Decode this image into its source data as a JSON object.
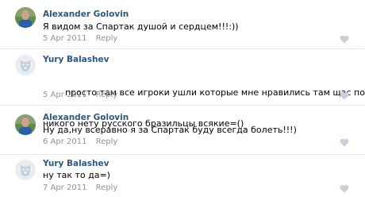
{
  "reply_label": "Reply",
  "colors": {
    "author": "#2a5885",
    "meta": "#939393",
    "text": "#000000",
    "like": "#c5d0db",
    "divider": "#e7e8ec"
  },
  "comments": [
    {
      "author": "Alexander Golovin",
      "text_lines": [
        "Я видом за Спартак душой и сердцем!!!:))"
      ],
      "date": "5 Apr 2011",
      "avatar": "user-photo",
      "like_icon": "heart-icon"
    },
    {
      "author": "Yury Balashev",
      "text_lines": [
        "        просто там все игроки ушли которые мне нравились там щас почти",
        "никого нету русского бразильцы всякие=()"
      ],
      "date": "5 Apr 2011",
      "avatar": "default-dog-avatar",
      "like_icon": "heart-icon"
    },
    {
      "author": "Alexander Golovin",
      "text_lines": [
        "Ну да,ну всеравно я за Спартак буду всегда болеть!!!)"
      ],
      "date": "6 Apr 2011",
      "avatar": "user-photo",
      "like_icon": "heart-icon"
    },
    {
      "author": "Yury Balashev",
      "text_lines": [
        "ну так то да=)"
      ],
      "date": "7 Apr 2011",
      "avatar": "default-dog-avatar",
      "like_icon": "heart-icon"
    }
  ]
}
